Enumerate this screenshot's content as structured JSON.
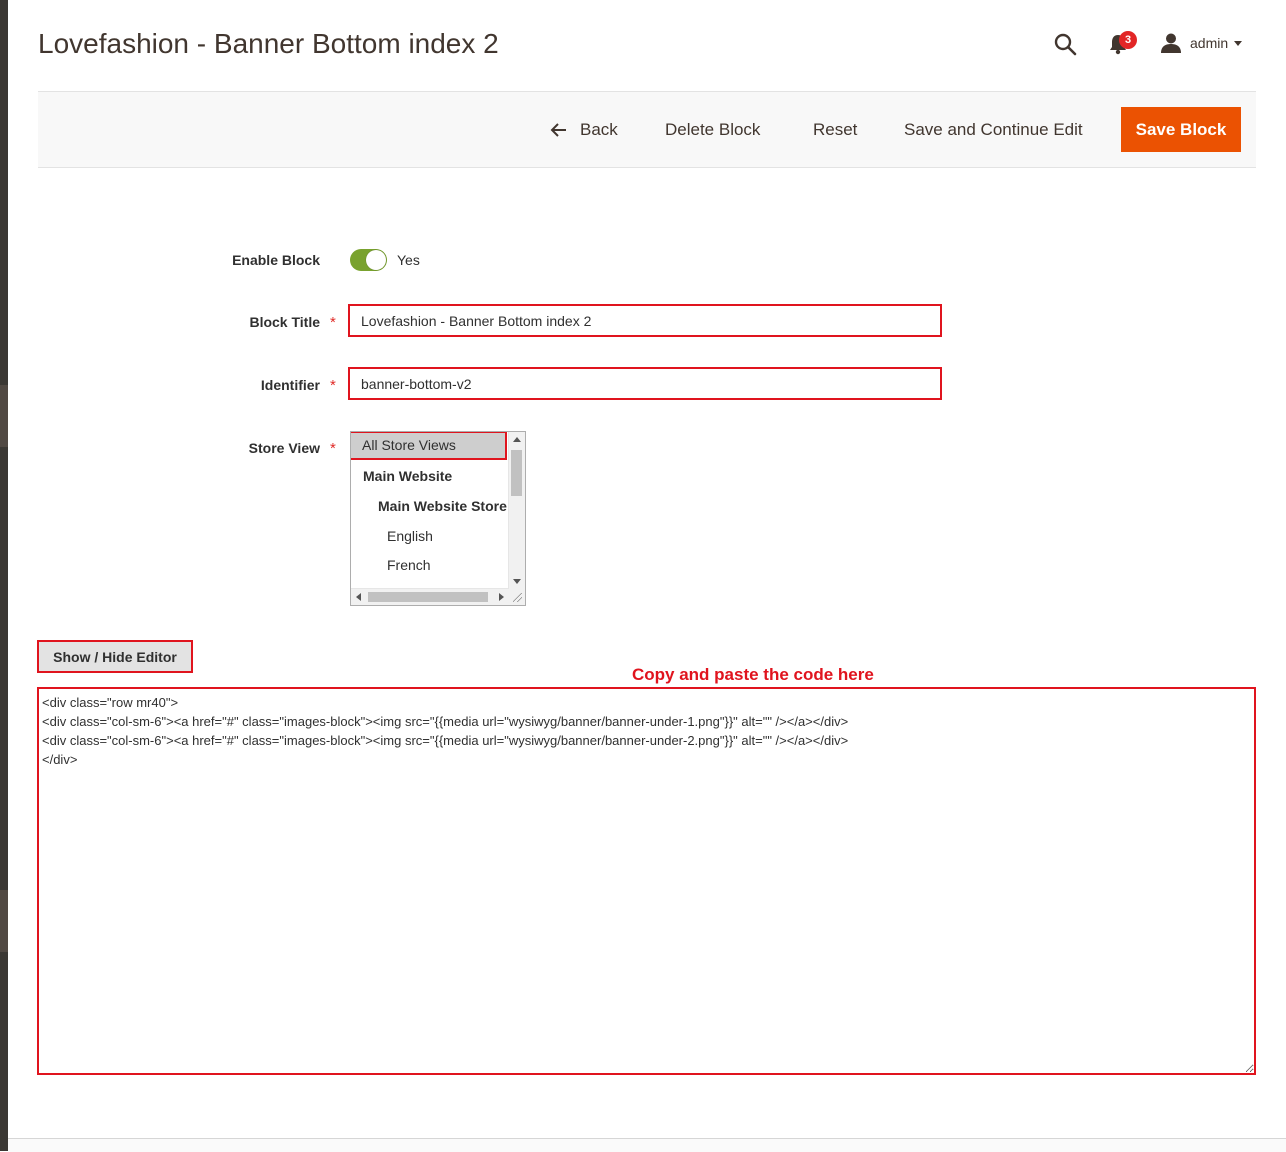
{
  "header": {
    "title": "Lovefashion - Banner Bottom index 2",
    "notifications_count": "3",
    "user_name": "admin",
    "icons": [
      "search-icon",
      "bell-icon",
      "user-icon",
      "caret-down-icon"
    ]
  },
  "toolbar": {
    "back_label": "Back",
    "delete_label": "Delete Block",
    "reset_label": "Reset",
    "save_continue_label": "Save and Continue Edit",
    "save_label": "Save Block"
  },
  "form": {
    "enable_block": {
      "label": "Enable Block",
      "value_text": "Yes",
      "enabled": true
    },
    "block_title": {
      "label": "Block Title",
      "value": "Lovefashion - Banner Bottom index 2"
    },
    "identifier": {
      "label": "Identifier",
      "value": "banner-bottom-v2"
    },
    "store_view": {
      "label": "Store View",
      "selected": "All Store Views",
      "options": [
        "Main Website",
        "Main Website Store",
        "English",
        "French"
      ]
    },
    "required_mark": "*"
  },
  "editor": {
    "toggle_label": "Show / Hide Editor",
    "annotation": "Copy and paste the code here",
    "content": "<div class=\"row mr40\">\n<div class=\"col-sm-6\"><a href=\"#\" class=\"images-block\"><img src=\"{{media url=\"wysiwyg/banner/banner-under-1.png\"}}\" alt=\"\" /></a></div>\n<div class=\"col-sm-6\"><a href=\"#\" class=\"images-block\"><img src=\"{{media url=\"wysiwyg/banner/banner-under-2.png\"}}\" alt=\"\" /></a></div>\n</div>"
  },
  "colors": {
    "accent": "#eb5202",
    "highlight": "#e0141e",
    "toggle_on": "#79a22e",
    "badge": "#e22626"
  }
}
